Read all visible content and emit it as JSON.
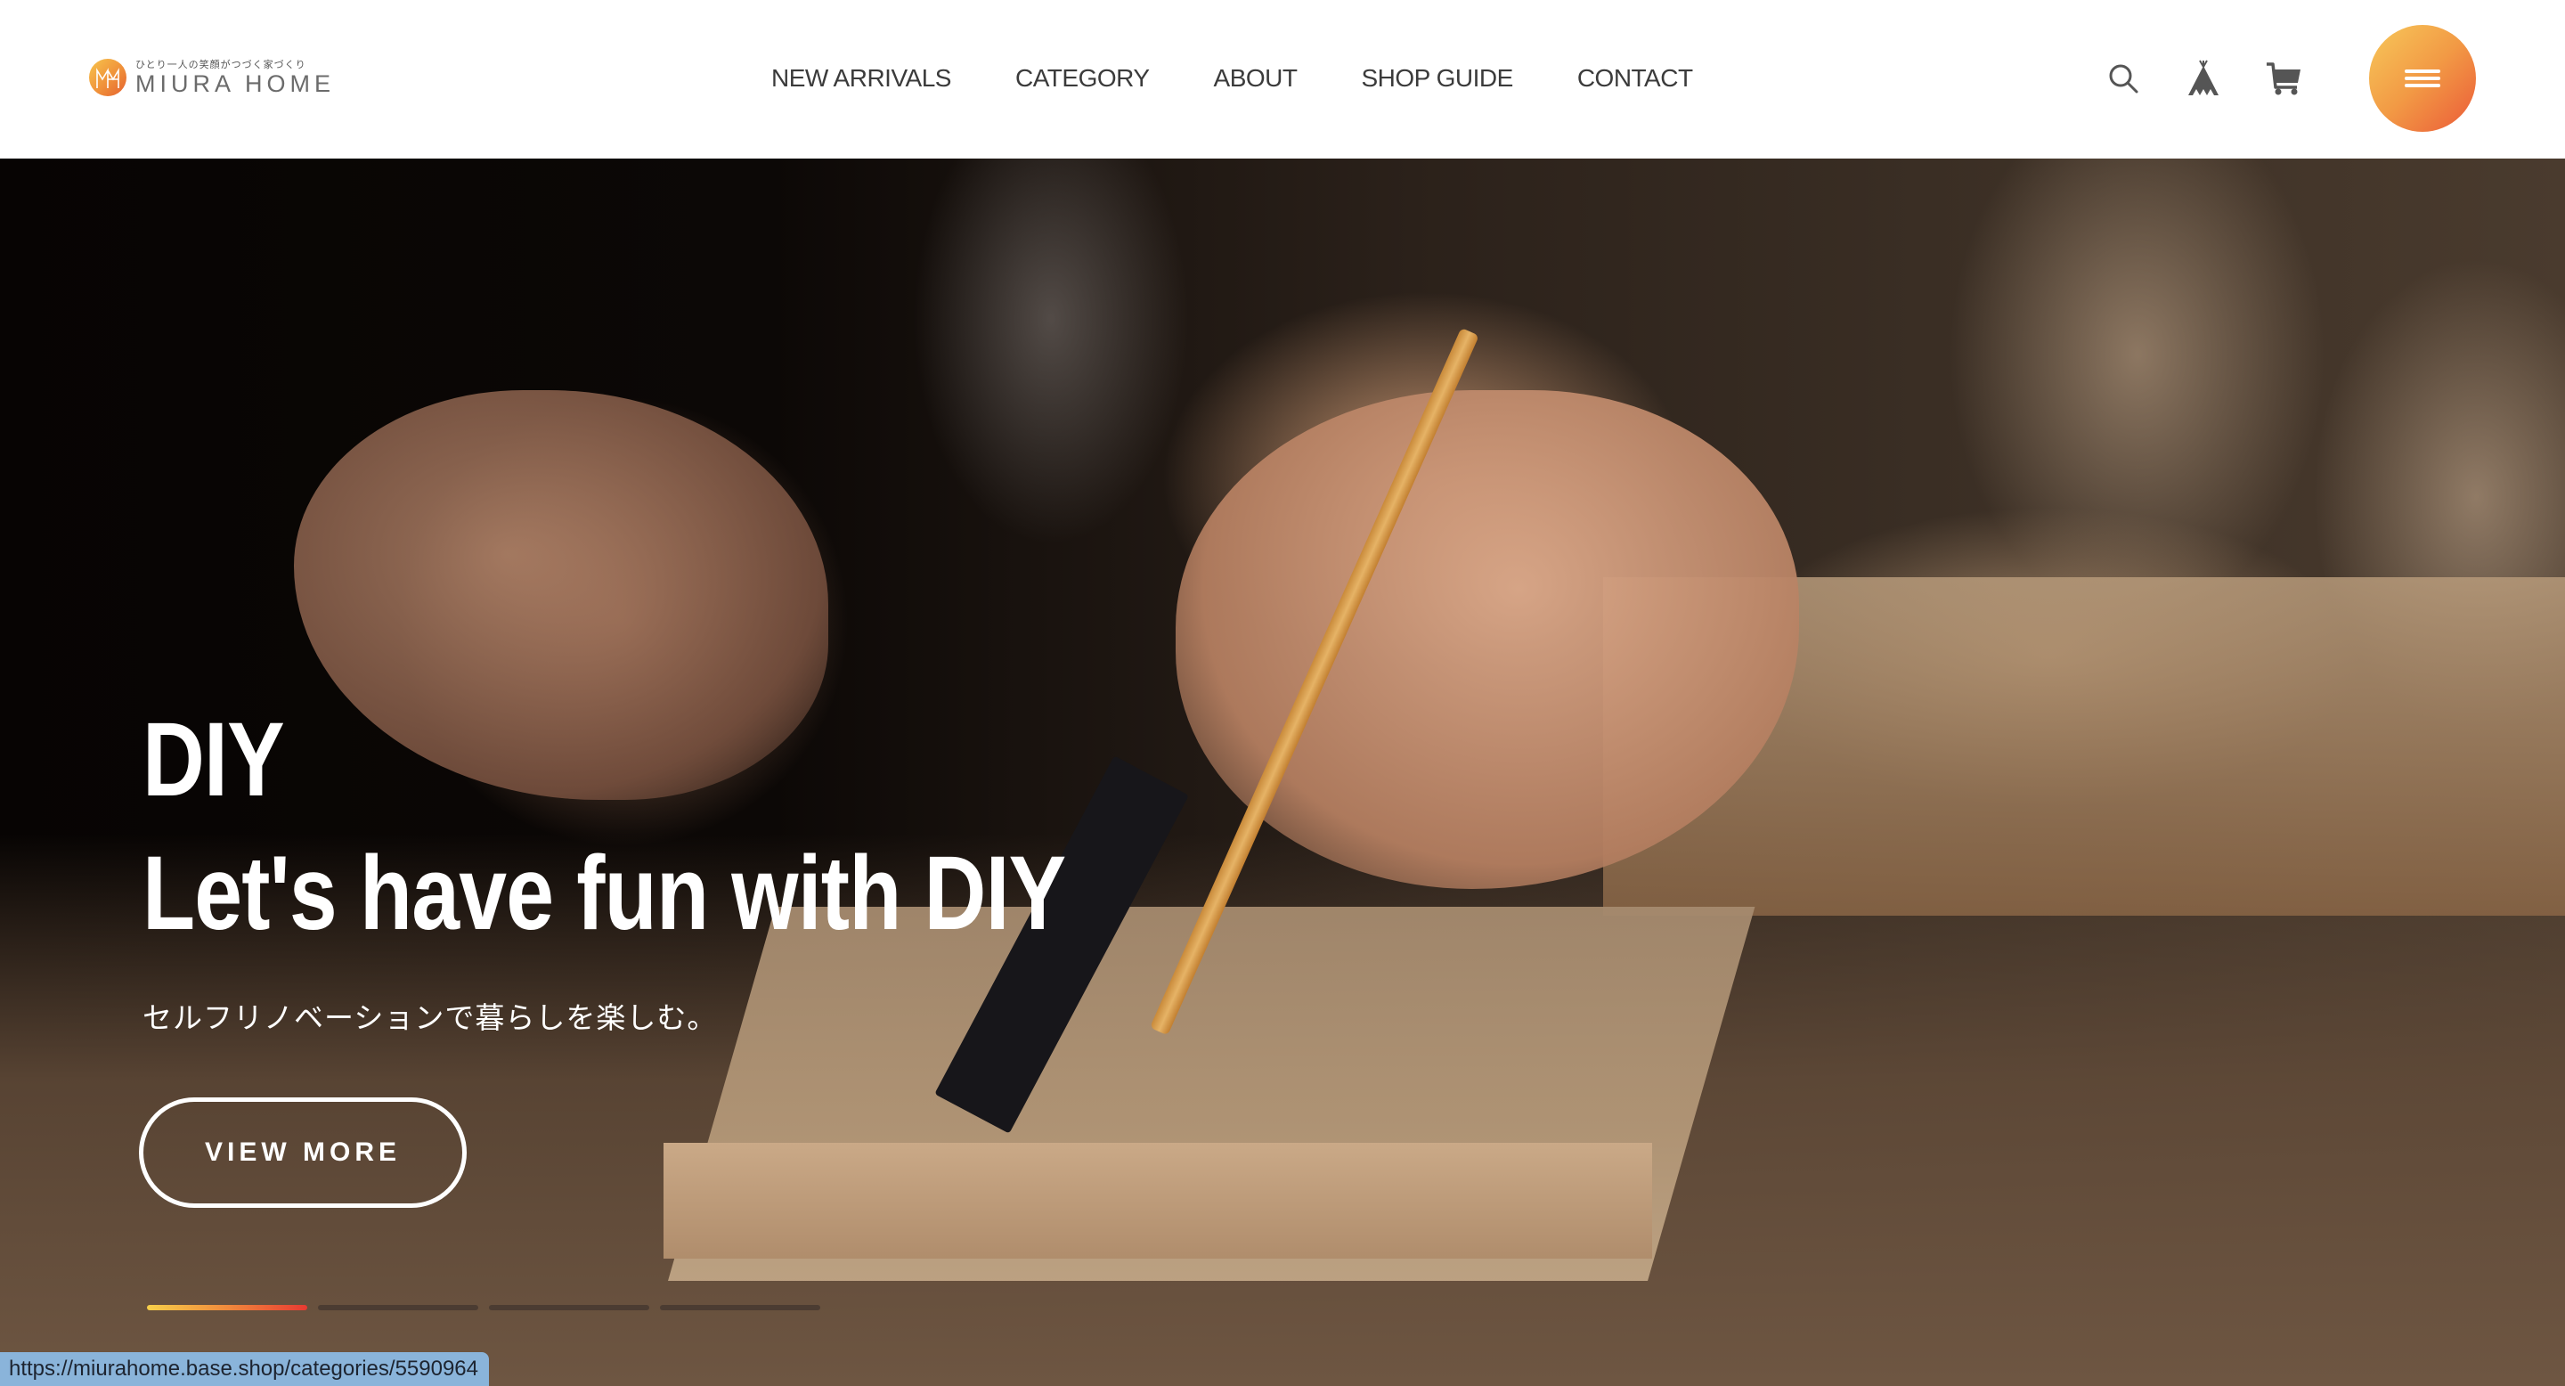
{
  "header": {
    "logo": {
      "tagline": "ひとり一人の笑顔がつづく家づくり",
      "name": "MIURA HOME",
      "mark_icon": "miura-home-logo-mark"
    },
    "nav": [
      {
        "label": "NEW ARRIVALS"
      },
      {
        "label": "CATEGORY"
      },
      {
        "label": "ABOUT"
      },
      {
        "label": "SHOP GUIDE"
      },
      {
        "label": "CONTACT"
      }
    ],
    "icons": [
      {
        "name": "search-icon"
      },
      {
        "name": "teepee-icon"
      },
      {
        "name": "cart-icon"
      }
    ],
    "menu_button_icon": "hamburger-icon",
    "menu_gradient": [
      "#f7c85a",
      "#eb5a38"
    ]
  },
  "hero": {
    "title_line1": "DIY",
    "title_line2": "Let's have fun with DIY",
    "subtitle": "セルフリノベーションで暮らしを楽しむ。",
    "cta_label": "VIEW MORE",
    "slides_total": 4,
    "active_slide": 1,
    "image_description": "hands marking wood with pencil and ruler on workbench"
  },
  "status_bar": {
    "url": "https://miurahome.base.shop/categories/5590964"
  },
  "colors": {
    "nav_text": "#3b3b3b",
    "accent_start": "#f6cf4a",
    "accent_end": "#e83a32",
    "status_bar_bg": "#8ab4da"
  }
}
